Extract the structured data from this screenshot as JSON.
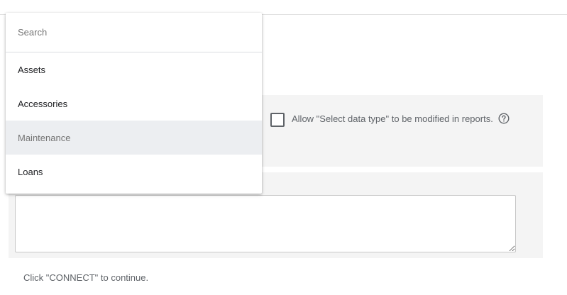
{
  "dropdown": {
    "search_placeholder": "Search",
    "items": [
      {
        "label": "Assets"
      },
      {
        "label": "Accessories"
      },
      {
        "label": "Maintenance"
      },
      {
        "label": "Loans"
      }
    ],
    "highlighted_item": "Maintenance"
  },
  "config": {
    "allow_modify_label": "Allow \"Select data type\" to be modified in reports.",
    "allow_modify_checked": false,
    "help_icon": "help-circle-icon"
  },
  "notes": {
    "value": ""
  },
  "footer": {
    "hint": "Click \"CONNECT\" to continue."
  }
}
